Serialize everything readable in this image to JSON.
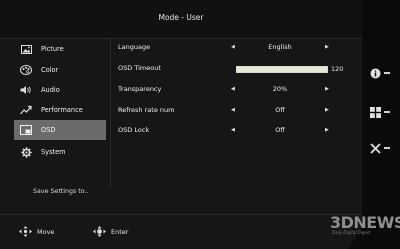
{
  "header": {
    "title": "Mode - User"
  },
  "sidebar": {
    "items": [
      {
        "label": "Picture",
        "icon": "picture-icon"
      },
      {
        "label": "Color",
        "icon": "color-palette-icon"
      },
      {
        "label": "Audio",
        "icon": "speaker-icon"
      },
      {
        "label": "Performance",
        "icon": "performance-graph-icon"
      },
      {
        "label": "OSD",
        "icon": "osd-screen-icon",
        "active": true
      },
      {
        "label": "System",
        "icon": "gear-icon"
      }
    ],
    "save_label": "Save Settings to.."
  },
  "settings": {
    "language": {
      "label": "Language",
      "value": "English"
    },
    "osd_timeout": {
      "label": "OSD Timeout",
      "value": "120",
      "level_fraction": 1.0
    },
    "transparency": {
      "label": "Transparency",
      "value": "20%"
    },
    "refresh_rate_num": {
      "label": "Refresh rate num",
      "value": "Off"
    },
    "osd_lock": {
      "label": "OSD Lock",
      "value": "Off"
    }
  },
  "footer": {
    "move_label": "Move",
    "enter_label": "Enter"
  },
  "hotkeys": [
    "info-icon",
    "input-grid-icon",
    "close-icon"
  ],
  "watermark": {
    "brand": "3DNEWS",
    "tagline": "Daily Digital Digest"
  },
  "colors": {
    "active_item": "#6b6b6b",
    "panel": "#161616",
    "slider_fill": "#e8e8d8"
  }
}
